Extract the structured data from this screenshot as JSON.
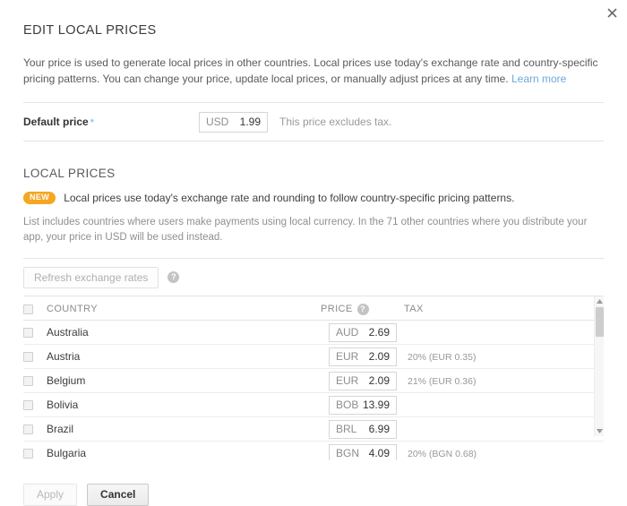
{
  "dialog": {
    "title": "EDIT LOCAL PRICES",
    "close_icon": "close-icon",
    "intro": "Your price is used to generate local prices in other countries. Local prices use today's exchange rate and country-specific pricing patterns. You can change your price, update local prices, or manually adjust prices at any time.",
    "intro_link": "Learn more"
  },
  "default_price": {
    "label": "Default price",
    "required_marker": "*",
    "currency": "USD",
    "value": "1.99",
    "hint": "This price excludes tax."
  },
  "local_prices": {
    "section_title": "LOCAL PRICES",
    "badge": "NEW",
    "badge_text": "Local prices use today's exchange rate and rounding to follow country-specific pricing patterns.",
    "note": "List includes countries where users make payments using local currency. In the 71 other countries where you distribute your app, your price in USD will be used instead.",
    "refresh_button": "Refresh exchange rates",
    "refresh_help_icon": "help-icon"
  },
  "table": {
    "headers": {
      "country": "COUNTRY",
      "price": "PRICE",
      "price_help_icon": "help-icon",
      "tax": "TAX"
    },
    "rows": [
      {
        "country": "Australia",
        "currency": "AUD",
        "price": "2.69",
        "tax": ""
      },
      {
        "country": "Austria",
        "currency": "EUR",
        "price": "2.09",
        "tax": "20% (EUR 0.35)"
      },
      {
        "country": "Belgium",
        "currency": "EUR",
        "price": "2.09",
        "tax": "21% (EUR 0.36)"
      },
      {
        "country": "Bolivia",
        "currency": "BOB",
        "price": "13.99",
        "tax": ""
      },
      {
        "country": "Brazil",
        "currency": "BRL",
        "price": "6.99",
        "tax": ""
      },
      {
        "country": "Bulgaria",
        "currency": "BGN",
        "price": "4.09",
        "tax": "20% (BGN 0.68)"
      }
    ]
  },
  "footer": {
    "apply": "Apply",
    "cancel": "Cancel"
  },
  "colors": {
    "badge_orange": "#f5a623",
    "link_blue": "#6fa8dc",
    "text_gray": "#8f8f8f"
  }
}
